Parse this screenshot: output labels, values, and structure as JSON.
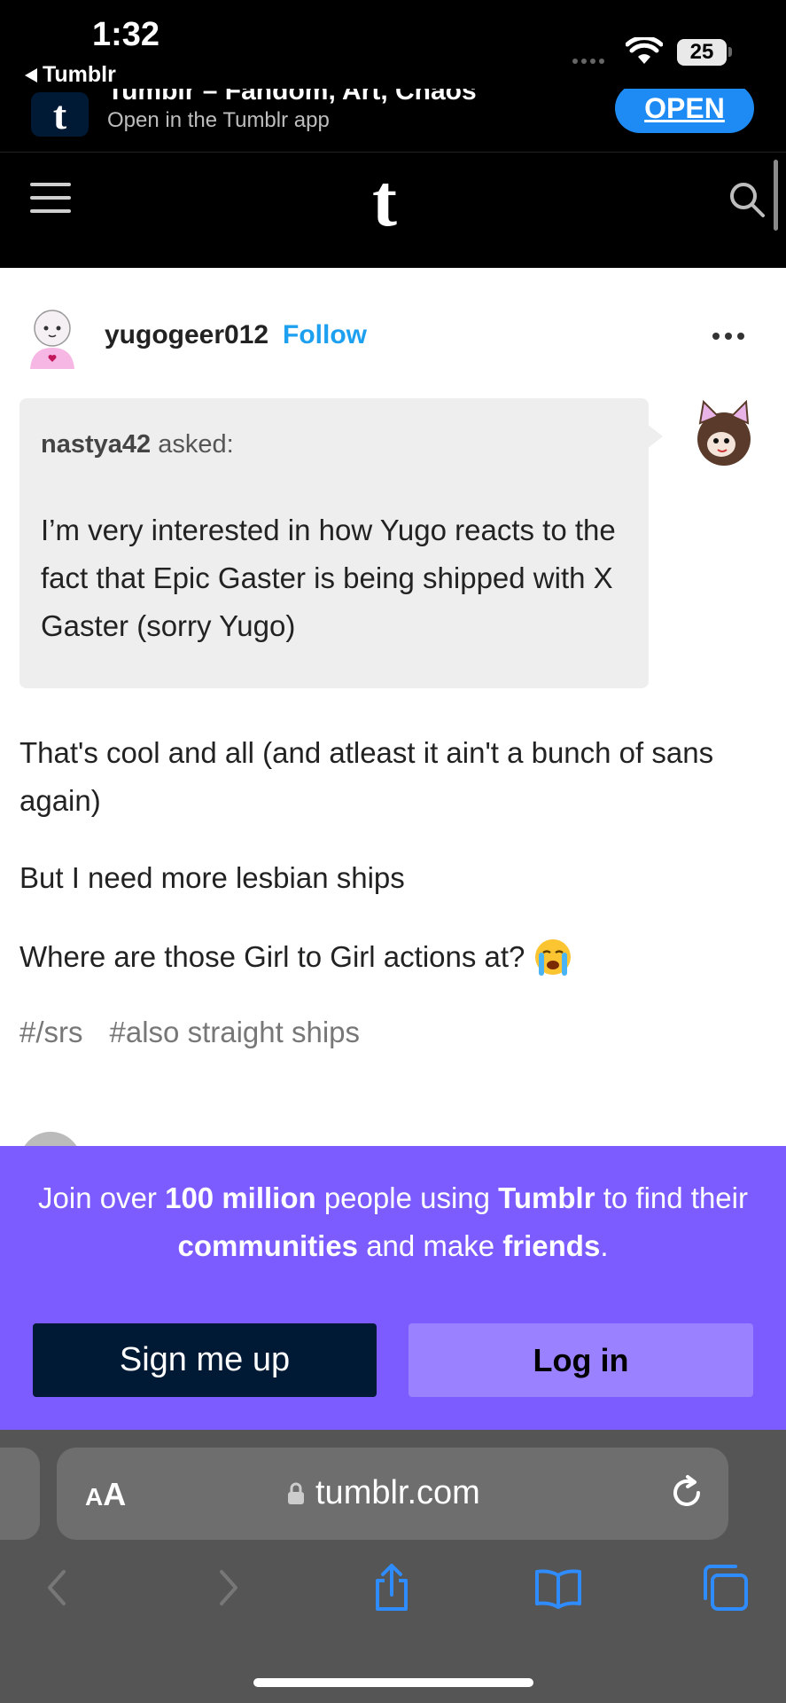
{
  "status_bar": {
    "time": "1:32",
    "back_app": "Tumblr",
    "battery": "25"
  },
  "app_banner": {
    "title": "Tumblr – Fandom, Art, Chaos",
    "subtitle": "Open in the Tumblr app",
    "open_label": "OPEN",
    "logo": "t"
  },
  "nav": {
    "logo": "t"
  },
  "post": {
    "username": "yugogeer012",
    "follow_label": "Follow",
    "ask": {
      "asker": "nastya42",
      "asked_label": "asked:",
      "question": "I’m very interested in how Yugo reacts to the fact that Epic Gaster is being shipped with X Gaster (sorry Yugo)"
    },
    "body": [
      "That's cool and all (and atleast it ain't a bunch of sans again)",
      "But I need more lesbian ships",
      "Where are those Girl to Girl actions at?"
    ],
    "tags": [
      "#/srs",
      "#also straight ships"
    ]
  },
  "signup": {
    "text_1": "Join over ",
    "bold_1": "100 million",
    "text_2": " people using ",
    "bold_2": "Tumblr",
    "text_3": " to find their ",
    "bold_3": "communities",
    "text_4": " and make ",
    "bold_4": "friends",
    "text_5": ".",
    "signup_label": "Sign me up",
    "login_label": "Log in"
  },
  "safari": {
    "aa_label_big": "A",
    "aa_label_small": "A",
    "url": "tumblr.com"
  },
  "colors": {
    "accent_blue": "#1ea0f0",
    "signup_purple": "#7c5cff",
    "navy": "#001935",
    "safari_blue": "#2f8cff"
  }
}
